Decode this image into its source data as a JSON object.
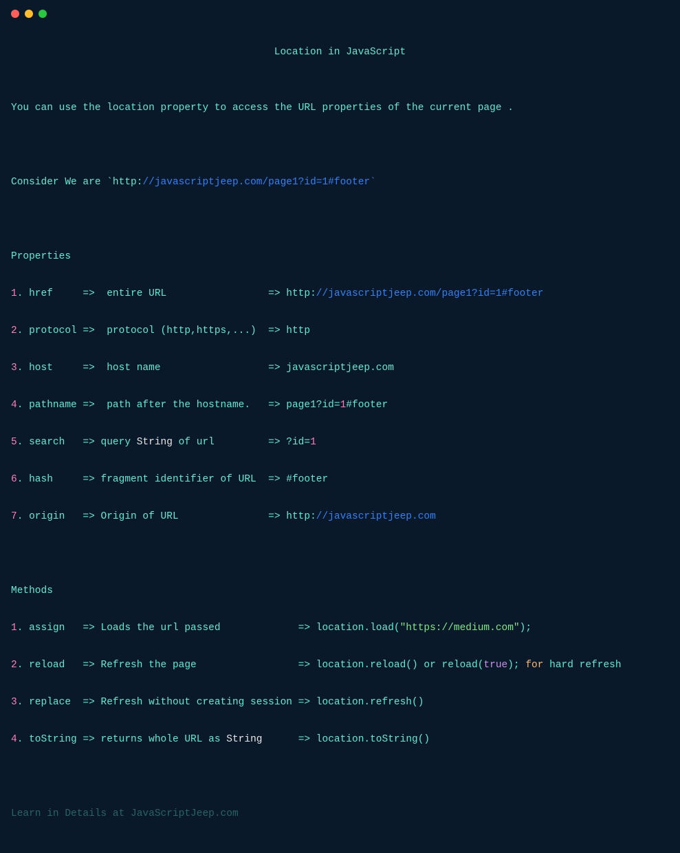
{
  "title": "Location in JavaScript",
  "intro": "You can use the location property to access the URL properties of the current page .",
  "consider_prefix": "Consider We are `http:",
  "consider_url": "//javascriptjeep.com/page1?id=1#footer`",
  "properties_header": "Properties",
  "properties": [
    {
      "num": "1",
      "name": "href",
      "desc": "entire URL",
      "result_prefix": "http:",
      "result_blue": "//javascriptjeep.com/page1?id=1#footer",
      "result_suffix": ""
    },
    {
      "num": "2",
      "name": "protocol",
      "desc": "protocol (http,https,...)",
      "result_prefix": "http",
      "result_blue": "",
      "result_suffix": ""
    },
    {
      "num": "3",
      "name": "host",
      "desc": "host name",
      "result_prefix": "javascriptjeep.com",
      "result_blue": "",
      "result_suffix": ""
    },
    {
      "num": "4",
      "name": "pathname",
      "desc": "path after the hostname.",
      "result_prefix": "page1?id=",
      "result_blue": "",
      "result_suffix": "",
      "pink_num": "1",
      "after_pink": "#footer"
    },
    {
      "num": "5",
      "name": "search",
      "desc_pre": "query ",
      "desc_white": "String",
      "desc_post": " of url",
      "result_prefix": "?id=",
      "result_blue": "",
      "result_suffix": "",
      "pink_num": "1",
      "after_pink": ""
    },
    {
      "num": "6",
      "name": "hash",
      "desc": "fragment identifier of URL",
      "result_prefix": "#footer",
      "result_blue": "",
      "result_suffix": ""
    },
    {
      "num": "7",
      "name": "origin",
      "desc": "Origin of URL",
      "result_prefix": "http:",
      "result_blue": "//javascriptjeep.com",
      "result_suffix": ""
    }
  ],
  "methods_header": "Methods",
  "methods": [
    {
      "num": "1",
      "name": "assign",
      "desc": "Loads the url passed",
      "code_pre": "location.load(",
      "code_str": "\"https://medium.com\"",
      "code_post": ");"
    },
    {
      "num": "2",
      "name": "reload",
      "desc": "Refresh the page",
      "code_pre": "location.reload() or reload(",
      "code_true": "true",
      "code_post2": "); ",
      "code_for": "for",
      "code_post3": " hard refresh"
    },
    {
      "num": "3",
      "name": "replace",
      "desc": "Refresh without creating session",
      "code_pre": "location.refresh()"
    },
    {
      "num": "4",
      "name": "toString",
      "desc_pre": "returns whole URL as ",
      "desc_white": "String",
      "code_pre": "location.toString()"
    }
  ],
  "footer": "Learn in Details at JavaScriptJeep.com"
}
